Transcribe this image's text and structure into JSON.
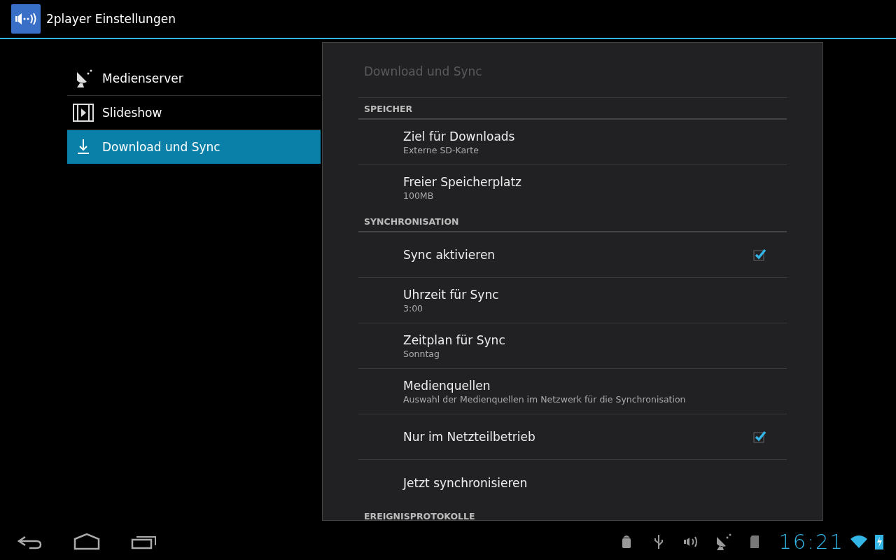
{
  "action_bar": {
    "title": "2player Einstellungen"
  },
  "sidebar": {
    "items": [
      {
        "label": "Medienserver",
        "kind": "dish",
        "selected": false
      },
      {
        "label": "Slideshow",
        "kind": "film",
        "selected": false
      },
      {
        "label": "Download und Sync",
        "kind": "download",
        "selected": true
      }
    ]
  },
  "panel": {
    "title": "Download und Sync",
    "sections": [
      {
        "header": "SPEICHER",
        "items": [
          {
            "kind": "text",
            "title": "Ziel für Downloads",
            "summary": "Externe SD-Karte"
          },
          {
            "kind": "text",
            "title": "Freier Speicherplatz",
            "summary": "100MB"
          }
        ]
      },
      {
        "header": "SYNCHRONISATION",
        "items": [
          {
            "kind": "checkbox",
            "title": "Sync aktivieren",
            "checked": true
          },
          {
            "kind": "text",
            "title": "Uhrzeit für Sync",
            "summary": "3:00"
          },
          {
            "kind": "text",
            "title": "Zeitplan für Sync",
            "summary": "Sonntag"
          },
          {
            "kind": "text",
            "title": "Medienquellen",
            "summary": "Auswahl der Medienquellen im Netzwerk für die Synchronisation"
          },
          {
            "kind": "checkbox",
            "title": "Nur im Netzteilbetrieb",
            "checked": true
          },
          {
            "kind": "action",
            "title": "Jetzt synchronisieren"
          }
        ]
      },
      {
        "header": "EREIGNISPROTOKOLLE"
      }
    ]
  },
  "system_bar": {
    "clock": "16:21"
  }
}
